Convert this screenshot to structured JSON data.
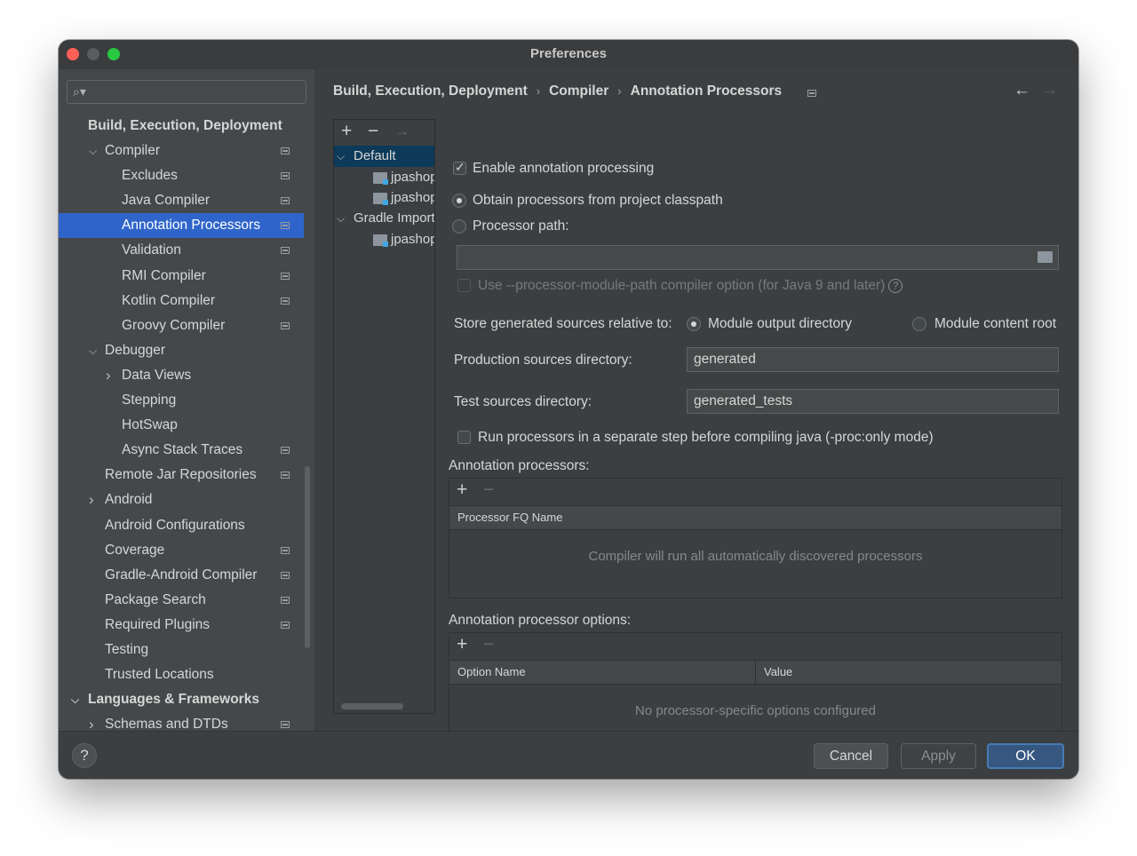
{
  "window": {
    "title": "Preferences"
  },
  "sidebar": {
    "items": [
      {
        "label": "Build, Execution, Deployment",
        "level": 0,
        "section": true,
        "scope": false,
        "selected": false,
        "chevron": ""
      },
      {
        "label": "Compiler",
        "level": 1,
        "chevron": "down",
        "scope": true
      },
      {
        "label": "Excludes",
        "level": 2,
        "scope": true
      },
      {
        "label": "Java Compiler",
        "level": 2,
        "scope": true
      },
      {
        "label": "Annotation Processors",
        "level": 2,
        "scope": true,
        "selected": true
      },
      {
        "label": "Validation",
        "level": 2,
        "scope": true
      },
      {
        "label": "RMI Compiler",
        "level": 2,
        "scope": true
      },
      {
        "label": "Kotlin Compiler",
        "level": 2,
        "scope": true
      },
      {
        "label": "Groovy Compiler",
        "level": 2,
        "scope": true
      },
      {
        "label": "Debugger",
        "level": 1,
        "chevron": "down"
      },
      {
        "label": "Data Views",
        "level": 2,
        "chevron": "right"
      },
      {
        "label": "Stepping",
        "level": 2
      },
      {
        "label": "HotSwap",
        "level": 2
      },
      {
        "label": "Async Stack Traces",
        "level": 2,
        "scope": true
      },
      {
        "label": "Remote Jar Repositories",
        "level": 1,
        "scope": true
      },
      {
        "label": "Android",
        "level": 1,
        "chevron": "right"
      },
      {
        "label": "Android Configurations",
        "level": 1
      },
      {
        "label": "Coverage",
        "level": 1,
        "scope": true
      },
      {
        "label": "Gradle-Android Compiler",
        "level": 1,
        "scope": true
      },
      {
        "label": "Package Search",
        "level": 1,
        "scope": true
      },
      {
        "label": "Required Plugins",
        "level": 1,
        "scope": true
      },
      {
        "label": "Testing",
        "level": 1
      },
      {
        "label": "Trusted Locations",
        "level": 1
      },
      {
        "label": "Languages & Frameworks",
        "level": 0,
        "section": true,
        "chevron": "down"
      },
      {
        "label": "Schemas and DTDs",
        "level": 1,
        "chevron": "right",
        "scope": true
      }
    ]
  },
  "breadcrumb": [
    "Build, Execution, Deployment",
    "Compiler",
    "Annotation Processors"
  ],
  "profiles": {
    "items": [
      {
        "label": "Default",
        "selected": true,
        "chevron": "down",
        "folder": false
      },
      {
        "label": "jpashop",
        "folder": true
      },
      {
        "label": "jpashop",
        "folder": true
      },
      {
        "label": "Gradle Imported",
        "chevron": "down",
        "folder": false
      },
      {
        "label": "jpashop",
        "folder": true
      }
    ]
  },
  "form": {
    "enable_annotation_processing": "Enable annotation processing",
    "obtain_from_classpath": "Obtain processors from project classpath",
    "processor_path": "Processor path:",
    "processor_path_value": "",
    "use_module_path": "Use --processor-module-path compiler option (for Java 9 and later)",
    "store_relative_label": "Store generated sources relative to:",
    "module_output_directory": "Module output directory",
    "module_content_root": "Module content root",
    "production_sources_label": "Production sources directory:",
    "production_sources_value": "generated",
    "test_sources_label": "Test sources directory:",
    "test_sources_value": "generated_tests",
    "run_separate_step": "Run processors in a separate step before compiling java (-proc:only mode)",
    "annotation_processors_label": "Annotation processors:",
    "processor_fq_name_header": "Processor FQ Name",
    "processors_empty": "Compiler will run all automatically discovered processors",
    "processor_options_label": "Annotation processor options:",
    "option_name_header": "Option Name",
    "value_header": "Value",
    "options_empty": "No processor-specific options configured"
  },
  "footer": {
    "help": "?",
    "cancel": "Cancel",
    "apply": "Apply",
    "ok": "OK"
  },
  "colors": {
    "selection": "#2f65ca",
    "background": "#3c3f41",
    "sidebar": "#45484a",
    "primary_button": "#365880"
  },
  "icons": {
    "add": "+",
    "remove": "−",
    "move": "→",
    "back": "←",
    "forward": "→",
    "chevron_down": "⌵",
    "chevron_right": "›",
    "search": "⌕"
  }
}
